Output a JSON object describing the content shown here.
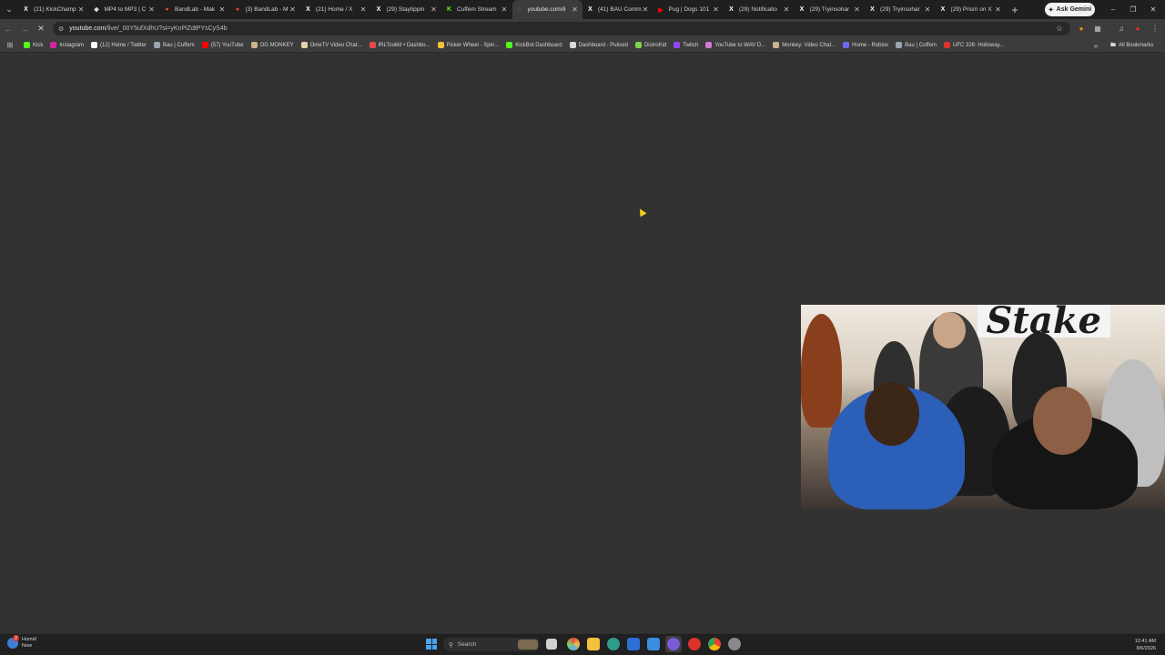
{
  "browser": {
    "tabs": [
      {
        "title": "(21) KickChamp",
        "icon": "x-logo-icon",
        "fav_color": "#ffffff",
        "glyph": "X"
      },
      {
        "title": "MP4 to MP3 | C",
        "icon": "converter-icon",
        "fav_color": "#e0e0e0",
        "glyph": "❖"
      },
      {
        "title": "BandLab - Mak",
        "icon": "bandlab-icon",
        "fav_color": "#e8443a",
        "glyph": "●"
      },
      {
        "title": "(3) BandLab - M",
        "icon": "bandlab-icon",
        "fav_color": "#e8443a",
        "glyph": "●"
      },
      {
        "title": "(21) Home / X",
        "icon": "x-logo-icon",
        "fav_color": "#ffffff",
        "glyph": "X"
      },
      {
        "title": "(29) Staytippin",
        "icon": "x-logo-icon",
        "fav_color": "#ffffff",
        "glyph": "X"
      },
      {
        "title": "Cuffem Stream",
        "icon": "kick-icon",
        "fav_color": "#53fc18",
        "glyph": "K"
      },
      {
        "title": "youtube.com/li",
        "icon": "loading-icon",
        "fav_color": "#9a9a9a",
        "glyph": "◌",
        "active": true
      },
      {
        "title": "(41) BAU Comm",
        "icon": "x-logo-icon",
        "fav_color": "#ffffff",
        "glyph": "X"
      },
      {
        "title": "Pug | Dogs 101",
        "icon": "youtube-icon",
        "fav_color": "#ff0000",
        "glyph": "▶"
      },
      {
        "title": "(29) Notificatio",
        "icon": "x-logo-icon",
        "fav_color": "#ffffff",
        "glyph": "X"
      },
      {
        "title": "(29) Tryinsohar",
        "icon": "x-logo-icon",
        "fav_color": "#ffffff",
        "glyph": "X"
      },
      {
        "title": "(29) Tryinsohar",
        "icon": "x-logo-icon",
        "fav_color": "#ffffff",
        "glyph": "X"
      },
      {
        "title": "(29) Prism on X",
        "icon": "x-logo-icon",
        "fav_color": "#ffffff",
        "glyph": "X"
      }
    ],
    "gemini_label": "Ask Gemini",
    "url_host": "youtube.com",
    "url_path": "/live/_00Y5ufXdhU?si=yKnPiZdtPYsCyS4b",
    "bookmarks": [
      {
        "label": "Kick",
        "color": "#53fc18"
      },
      {
        "label": "Instagram",
        "color": "#d6249f"
      },
      {
        "label": "(12) Home / Twitter",
        "color": "#ffffff"
      },
      {
        "label": "Bau | Cuffem",
        "color": "#9aa4b5"
      },
      {
        "label": "(57) YouTube",
        "color": "#ff0000"
      },
      {
        "label": "OG MONKEY",
        "color": "#c9b38a"
      },
      {
        "label": "OmeTV Video Chat...",
        "color": "#e8d4a8"
      },
      {
        "label": "IRLToolkit • Dashbo...",
        "color": "#e84a4a"
      },
      {
        "label": "Picker Wheel - Spin...",
        "color": "#f3c13a"
      },
      {
        "label": "KickBot Dashboard",
        "color": "#53fc18"
      },
      {
        "label": "Dashboard - Pulsoid",
        "color": "#dadada"
      },
      {
        "label": "DistroKid",
        "color": "#7bd34a"
      },
      {
        "label": "Twitch",
        "color": "#9146ff"
      },
      {
        "label": "YouTube to WAV D...",
        "color": "#d27bd0"
      },
      {
        "label": "Monkey: Video Chat...",
        "color": "#c9b38a"
      },
      {
        "label": "Home - Roblox",
        "color": "#6b6bf0"
      },
      {
        "label": "Bau | Cuffem",
        "color": "#9aa4b5"
      },
      {
        "label": "UFC 326: Holloway...",
        "color": "#d9332b"
      }
    ],
    "all_bookmarks_label": "All Bookmarks"
  },
  "video": {
    "sign_text": "Stake"
  },
  "taskbar": {
    "weather_line1": "Humid",
    "weather_line2": "Now",
    "weather_badge": "2",
    "search_placeholder": "Search",
    "time": "12:41 AM",
    "date": "8/6/2026"
  }
}
